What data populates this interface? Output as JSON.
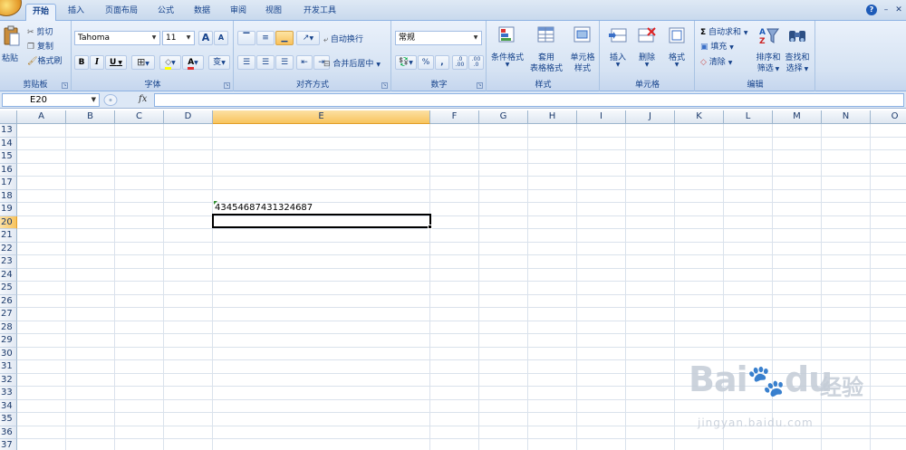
{
  "tabs": [
    {
      "label": "开始",
      "active": true
    },
    {
      "label": "插入"
    },
    {
      "label": "页面布局"
    },
    {
      "label": "公式"
    },
    {
      "label": "数据"
    },
    {
      "label": "审阅"
    },
    {
      "label": "视图"
    },
    {
      "label": "开发工具"
    }
  ],
  "clipboard": {
    "paste": "粘贴",
    "cut": "剪切",
    "copy": "复制",
    "format_painter": "格式刷",
    "group": "剪贴板"
  },
  "font": {
    "name": "Tahoma",
    "size": "11",
    "grow": "A",
    "shrink": "A",
    "bold": "B",
    "italic": "I",
    "underline": "U",
    "font_color": "A",
    "phonetic": "变",
    "group": "字体"
  },
  "alignment": {
    "wrap": "自动换行",
    "merge": "合并后居中",
    "group": "对齐方式"
  },
  "number": {
    "format": "常规",
    "percent": "%",
    "comma": ",",
    "inc_decimal": ".0 .00",
    "dec_decimal": ".00 .0",
    "group": "数字"
  },
  "styles": {
    "conditional_l1": "条件格式",
    "table_l1": "套用",
    "table_l2": "表格格式",
    "cell_l1": "单元格",
    "cell_l2": "样式",
    "group": "样式"
  },
  "cells": {
    "insert": "插入",
    "delete": "删除",
    "format": "格式",
    "group": "单元格"
  },
  "editing": {
    "autosum": "自动求和",
    "fill": "填充",
    "clear": "清除",
    "sort_l1": "排序和",
    "sort_l2": "筛选",
    "find_l1": "查找和",
    "find_l2": "选择",
    "group": "编辑"
  },
  "formula_bar": {
    "name_box": "E20",
    "fx": "fx",
    "content": ""
  },
  "sheet": {
    "columns": [
      "A",
      "B",
      "C",
      "D",
      "E",
      "F",
      "G",
      "H",
      "I",
      "J",
      "K",
      "L",
      "M",
      "N",
      "O"
    ],
    "rows": [
      "13",
      "14",
      "15",
      "16",
      "17",
      "18",
      "19",
      "20",
      "21",
      "22",
      "23",
      "24",
      "25",
      "26",
      "27",
      "28",
      "29",
      "30",
      "31",
      "32",
      "33",
      "34",
      "35",
      "36",
      "37"
    ],
    "selected_cell": "E20",
    "cell_E19": "43454687431324687"
  },
  "watermark": {
    "brand": "Bai",
    "brand2": "du",
    "suffix": "经验",
    "url": "jingyan.baidu.com"
  },
  "colors": {
    "accent": "#15428b",
    "selected_header": "#f8c45e",
    "ribbon": "#d6e3f3"
  }
}
